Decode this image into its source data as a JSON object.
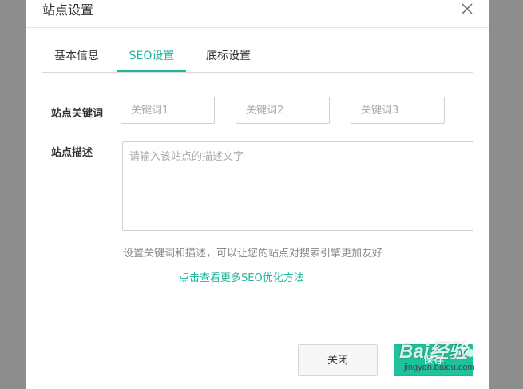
{
  "dialog": {
    "title": "站点设置",
    "close_icon": "close-icon"
  },
  "tabs": [
    {
      "label": "基本信息",
      "active": false
    },
    {
      "label": "SEO设置",
      "active": true
    },
    {
      "label": "底标设置",
      "active": false
    }
  ],
  "keywords": {
    "label": "站点关键词",
    "inputs": [
      {
        "placeholder": "关键词1",
        "value": ""
      },
      {
        "placeholder": "关键词2",
        "value": ""
      },
      {
        "placeholder": "关键词3",
        "value": ""
      }
    ]
  },
  "description": {
    "label": "站点描述",
    "placeholder": "请输入该站点的描述文字",
    "value": ""
  },
  "hint_text": "设置关键词和描述，可以让您的站点对搜索引擎更加友好",
  "seo_link": "点击查看更多SEO优化方法",
  "buttons": {
    "close_label": "关闭",
    "save_label": "保存"
  },
  "watermark": {
    "brand": "Bai经验",
    "url": "jingyan.baidu.com"
  },
  "colors": {
    "accent": "#1fb59a",
    "save_button": "#1fc29a",
    "overlay": "#8d8d8d"
  }
}
